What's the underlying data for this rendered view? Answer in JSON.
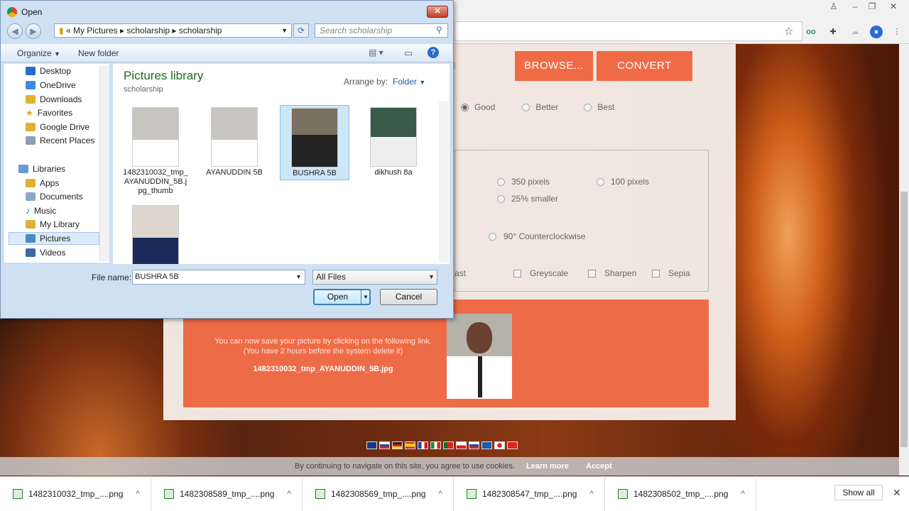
{
  "dialog": {
    "title": "Open",
    "path": [
      "My Pictures",
      "scholarship",
      "scholarship"
    ],
    "search_placeholder": "Search scholarship",
    "toolbar": {
      "organize": "Organize",
      "new_folder": "New folder"
    },
    "library": {
      "title": "Pictures library",
      "subtitle": "scholarship",
      "arrange_label": "Arrange by:",
      "arrange_value": "Folder"
    },
    "nav": [
      {
        "label": "Desktop",
        "icon": "desktop-icon"
      },
      {
        "label": "OneDrive",
        "icon": "cloud-icon"
      },
      {
        "label": "Downloads",
        "icon": "folder-icon"
      },
      {
        "label": "Favorites",
        "icon": "star-icon"
      },
      {
        "label": "Google Drive",
        "icon": "folder-icon"
      },
      {
        "label": "Recent Places",
        "icon": "recent-icon"
      },
      {
        "label": "Libraries",
        "icon": "library-icon"
      },
      {
        "label": "Apps",
        "icon": "folder-icon"
      },
      {
        "label": "Documents",
        "icon": "documents-icon"
      },
      {
        "label": "Music",
        "icon": "music-icon"
      },
      {
        "label": "My Library",
        "icon": "folder-icon"
      },
      {
        "label": "Pictures",
        "icon": "pictures-icon"
      },
      {
        "label": "Videos",
        "icon": "videos-icon"
      }
    ],
    "files": [
      {
        "name": "1482310032_tmp_ AYANUDDIN_5B.j pg_thumb",
        "selected": false
      },
      {
        "name": "AYANUDDIN 5B",
        "selected": false
      },
      {
        "name": "BUSHRA 5B",
        "selected": true
      },
      {
        "name": "dikhush 8a",
        "selected": false
      },
      {
        "name": "",
        "selected": false
      }
    ],
    "file_name_label": "File name:",
    "file_name_value": "BUSHRA 5B",
    "file_type": "All Files",
    "open_label": "Open",
    "cancel_label": "Cancel"
  },
  "page": {
    "input_hint": "g",
    "browse_label": "BROWSE...",
    "convert_label": "CONVERT",
    "quality": [
      "Good",
      "Better",
      "Best"
    ],
    "resize": [
      "350 pixels",
      "100 pixels",
      "25% smaller"
    ],
    "rotate": "90° Counterclockwise",
    "effects": [
      "ast",
      "Greyscale",
      "Sharpen",
      "Sepia"
    ],
    "result_text_1": "You can now save your picture by clicking on the following link.",
    "result_text_2": "(You have 2 hours before the system delete it)",
    "result_link": "1482310032_tmp_AYANUDDIN_5B.jpg",
    "cookie_text": "By continuing to navigate on this site, you agree to use cookies.",
    "cookie_learn": "Learn more",
    "cookie_accept": "Accept"
  },
  "downloads": {
    "items": [
      "1482310032_tmp_....png",
      "1482308589_tmp_....png",
      "1482308569_tmp_....png",
      "1482308547_tmp_....png",
      "1482308502_tmp_....png"
    ],
    "show_all": "Show all"
  },
  "colors": {
    "accent": "#f06a46",
    "result_bg": "#ee6b47",
    "library_title": "#1e6a1e"
  }
}
